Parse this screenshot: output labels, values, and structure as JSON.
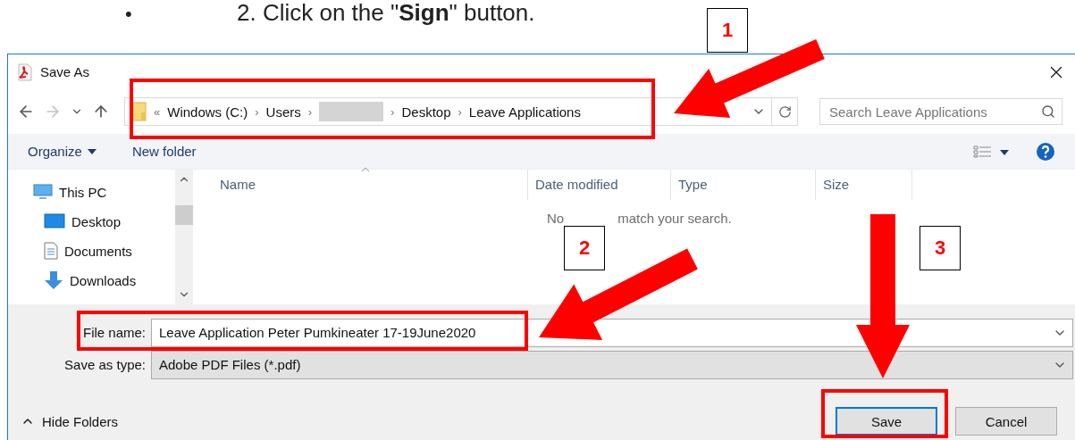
{
  "instruction": {
    "bullet": "•",
    "text": "2. Click on the \"**Sign**\" button."
  },
  "window": {
    "title": "Save As"
  },
  "nav": [
    {
      "kind": "back",
      "disabled": false
    },
    {
      "kind": "forward",
      "disabled": true
    },
    {
      "kind": "recent",
      "disabled": false
    },
    {
      "kind": "up",
      "disabled": false
    }
  ],
  "address": {
    "overflow": "«",
    "separator": "›",
    "crumbs": [
      {
        "kind": "text",
        "label": "Windows (C:)"
      },
      {
        "kind": "text",
        "label": "Users"
      },
      {
        "kind": "redacted"
      },
      {
        "kind": "text",
        "label": "Desktop"
      },
      {
        "kind": "text",
        "label": "Leave Applications"
      }
    ]
  },
  "search": {
    "placeholder": "Search Leave Applications"
  },
  "toolbar": {
    "organize": "Organize",
    "new_folder": "New folder"
  },
  "sidebar": {
    "items": [
      {
        "label": "This PC",
        "kind": "pc",
        "children": [
          {
            "label": "Desktop",
            "kind": "desktop"
          },
          {
            "label": "Documents",
            "kind": "documents"
          },
          {
            "label": "Downloads",
            "kind": "downloads"
          }
        ]
      }
    ]
  },
  "table": {
    "columns": [
      {
        "label": "Name",
        "sorted": true
      },
      {
        "label": "Date modified",
        "sorted": false
      },
      {
        "label": "Type",
        "sorted": false
      },
      {
        "label": "Size",
        "sorted": false
      }
    ],
    "empty_message": [
      "No",
      "match your search."
    ]
  },
  "file_name": {
    "label": "File name:",
    "value": "Leave Application Peter Pumkineater 17-19June2020"
  },
  "save_type": {
    "label": "Save as type:",
    "value": "Adobe PDF Files (*.pdf)"
  },
  "hide_folders": "Hide Folders",
  "buttons": [
    {
      "label": "Save",
      "default": true
    },
    {
      "label": "Cancel",
      "default": false
    }
  ],
  "callouts": [
    {
      "label": "1"
    },
    {
      "label": "2"
    },
    {
      "label": "3"
    }
  ]
}
